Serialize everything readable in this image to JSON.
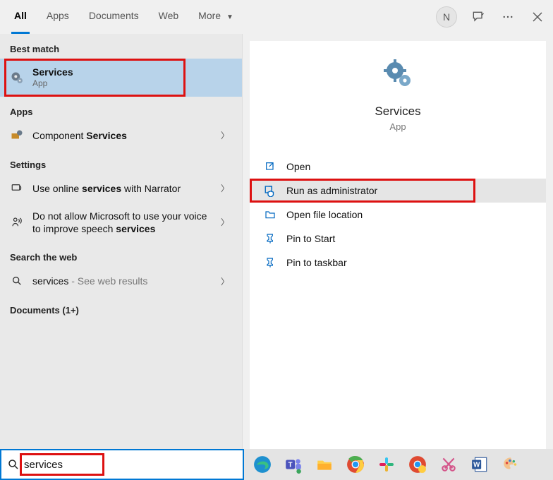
{
  "tabs": {
    "all": "All",
    "apps": "Apps",
    "documents": "Documents",
    "web": "Web",
    "more": "More"
  },
  "user_initial": "N",
  "sections": {
    "best_match": "Best match",
    "apps": "Apps",
    "settings": "Settings",
    "search_web": "Search the web",
    "documents": "Documents (1+)"
  },
  "best_match": {
    "title": "Services",
    "subtitle": "App"
  },
  "apps_results": [
    {
      "prefix": "Component ",
      "bold": "Services"
    }
  ],
  "settings_results": [
    {
      "pre": "Use online ",
      "bold": "services",
      "post": " with Narrator"
    },
    {
      "pre": "Do not allow Microsoft to use your voice to improve speech ",
      "bold": "services",
      "post": ""
    }
  ],
  "web_result": {
    "term": "services",
    "tail": " - See web results"
  },
  "detail": {
    "title": "Services",
    "subtitle": "App",
    "actions": {
      "open": "Open",
      "run_admin": "Run as administrator",
      "open_loc": "Open file location",
      "pin_start": "Pin to Start",
      "pin_taskbar": "Pin to taskbar"
    }
  },
  "search": {
    "value": "services"
  },
  "taskbar_items": [
    "edge-icon",
    "teams-icon",
    "explorer-icon",
    "chrome-icon",
    "slack-icon",
    "chrome-canary-icon",
    "snip-icon",
    "word-icon",
    "paint-icon"
  ]
}
